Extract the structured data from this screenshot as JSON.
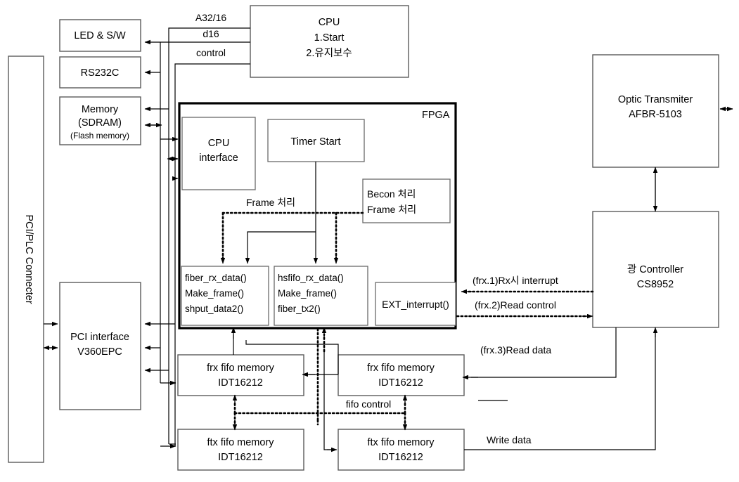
{
  "diagram": {
    "title": "FPGA optical communication board block diagram",
    "colors": {
      "line": "#000000",
      "box_stroke": "#5a5a5a",
      "fpga_stroke": "#000000",
      "background": "#ffffff"
    }
  },
  "blocks": {
    "pci_plc_connector": {
      "label": "PCI/PLC Connecter"
    },
    "led_sw": {
      "label": "LED & S/W"
    },
    "rs232c": {
      "label": "RS232C"
    },
    "memory": {
      "line1": "Memory",
      "line2": "(SDRAM)",
      "line3": "(Flash memory)"
    },
    "cpu": {
      "line1": "CPU",
      "line2": "1.Start",
      "line3": "2.유지보수"
    },
    "pci_interface": {
      "line1": "PCI interface",
      "line2": "V360EPC"
    },
    "fpga": {
      "label": "FPGA"
    },
    "cpu_interface": {
      "line1": "CPU",
      "line2": "interface"
    },
    "timer_start": {
      "label": "Timer Start"
    },
    "becon": {
      "line1": "Becon 처리",
      "line2": "Frame 처리"
    },
    "fiber_rx": {
      "line1": "fiber_rx_data()",
      "line2": "Make_frame()",
      "line3": "shput_data2()"
    },
    "hsfifo_rx": {
      "line1": "hsfifo_rx_data()",
      "line2": "Make_frame()",
      "line3": "fiber_tx2()"
    },
    "ext_interrupt": {
      "label": "EXT_interrupt()"
    },
    "optic_transmitter": {
      "line1": "Optic Transmiter",
      "line2": "AFBR-5103"
    },
    "optic_controller": {
      "line1": "광 Controller",
      "line2": "CS8952"
    },
    "frx_fifo_left": {
      "line1": "frx fifo memory",
      "line2": "IDT16212"
    },
    "frx_fifo_right": {
      "line1": "frx fifo memory",
      "line2": "IDT16212"
    },
    "ftx_fifo_left": {
      "line1": "ftx fifo memory",
      "line2": "IDT16212"
    },
    "ftx_fifo_right": {
      "line1": "ftx fifo memory",
      "line2": "IDT16212"
    }
  },
  "bus_labels": {
    "a32_16": "A32/16",
    "d16": "d16",
    "control": "control"
  },
  "signal_labels": {
    "frame_processing": "Frame 처리",
    "rx_interrupt": "(frx.1)Rx시 interrupt",
    "read_control": "(frx.2)Read control",
    "read_data": "(frx.3)Read data",
    "fifo_control": "fifo control",
    "write_data": "Write data"
  }
}
